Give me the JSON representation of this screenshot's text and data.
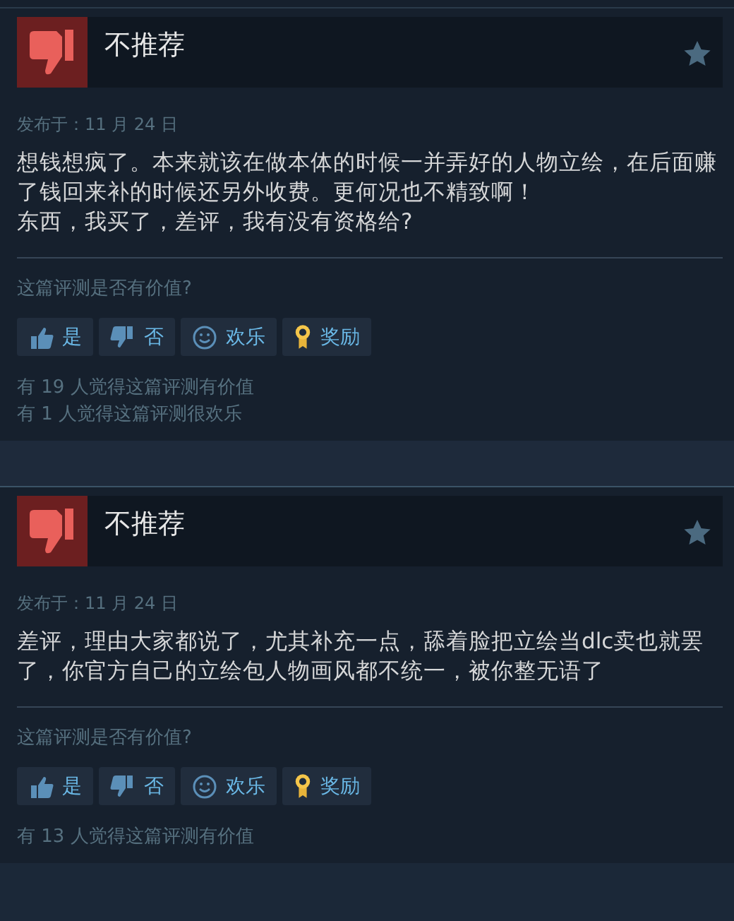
{
  "reviews": [
    {
      "verdict": "不推荐",
      "recommended": false,
      "posted": "发布于：11 月 24 日",
      "paragraphs": [
        "想钱想疯了。本来就该在做本体的时候一并弄好的人物立绘，在后面赚了钱回来补的时候还另外收费。更何况也不精致啊！",
        "东西，我买了，差评，我有没有资格给?"
      ],
      "question": "这篇评测是否有价值?",
      "buttons": [
        {
          "kind": "yes",
          "label": "是"
        },
        {
          "kind": "no",
          "label": "否"
        },
        {
          "kind": "funny",
          "label": "欢乐"
        },
        {
          "kind": "award",
          "label": "奖励"
        }
      ],
      "counts": [
        "有 19 人觉得这篇评测有价值",
        "有 1 人觉得这篇评测很欢乐"
      ]
    },
    {
      "verdict": "不推荐",
      "recommended": false,
      "posted": "发布于：11 月 24 日",
      "paragraphs": [
        "差评，理由大家都说了，尤其补充一点，舔着脸把立绘当dlc卖也就罢了，你官方自己的立绘包人物画风都不统一，被你整无语了"
      ],
      "question": "这篇评测是否有价值?",
      "buttons": [
        {
          "kind": "yes",
          "label": "是"
        },
        {
          "kind": "no",
          "label": "否"
        },
        {
          "kind": "funny",
          "label": "欢乐"
        },
        {
          "kind": "award",
          "label": "奖励"
        }
      ],
      "counts": [
        "有 13 人觉得这篇评测有价值"
      ]
    }
  ]
}
